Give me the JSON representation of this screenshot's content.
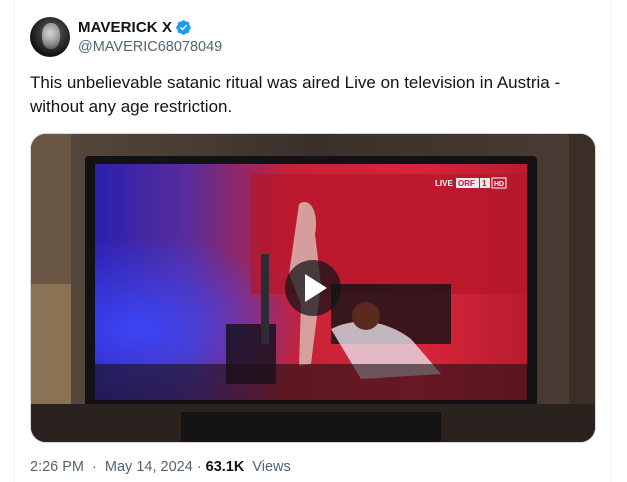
{
  "author": {
    "display_name": "MAVERICK X",
    "handle": "@MAVERIC68078049",
    "avatar_icon": "user-avatar",
    "verified_icon": "verified-badge-icon",
    "verified_color": "#1d9bf0"
  },
  "tweet": {
    "text": "This unbelievable satanic ritual was aired Live on television in Austria - without any age restriction."
  },
  "media": {
    "type": "video",
    "overlay_badge": "LIVE ORF 1 HD",
    "badge_live": "LIVE",
    "badge_channel": "ORF",
    "badge_num": "1",
    "badge_hd": "HD",
    "play_icon": "play-icon"
  },
  "meta": {
    "time": "2:26 PM",
    "date": "May 14, 2024",
    "separator": "·",
    "views_count": "63.1K",
    "views_label": "Views"
  },
  "colors": {
    "text_primary": "#0f1419",
    "text_secondary": "#536471",
    "border": "#cfd9de",
    "accent": "#1d9bf0"
  }
}
